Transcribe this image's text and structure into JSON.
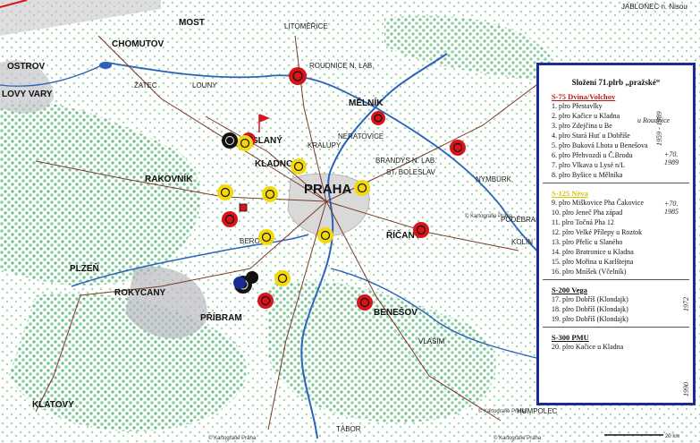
{
  "towns": [
    {
      "name": "MOST",
      "key": "most"
    },
    {
      "name": "LITOMĚŘICE",
      "key": "litomerice"
    },
    {
      "name": "CHOMUTOV",
      "key": "chomutov"
    },
    {
      "name": "OSTROV",
      "key": "ostrov"
    },
    {
      "name": "ŽATEC",
      "key": "zatec"
    },
    {
      "name": "ROUDNICE N. LAB.",
      "key": "roudnice"
    },
    {
      "name": "MĚLNÍK",
      "key": "melnik"
    },
    {
      "name": "SLANÝ",
      "key": "slany"
    },
    {
      "name": "NERATOVICE",
      "key": "neratovice"
    },
    {
      "name": "KRALUPY",
      "key": "kralupy"
    },
    {
      "name": "KLADNO",
      "key": "kladno"
    },
    {
      "name": "BRANDÝS N. LAB.",
      "key": "brandys"
    },
    {
      "name": "ST. BOLESLAV",
      "key": "boleslav"
    },
    {
      "name": "PRAHA",
      "key": "praha"
    },
    {
      "name": "RAKOVNÍK",
      "key": "rakovnik"
    },
    {
      "name": "NYMBURK",
      "key": "nymburk"
    },
    {
      "name": "PODĚBRADY",
      "key": "podebrady"
    },
    {
      "name": "ŘÍČANY",
      "key": "ricany"
    },
    {
      "name": "BEROUN",
      "key": "beroun"
    },
    {
      "name": "PLZEŇ",
      "key": "plzen"
    },
    {
      "name": "ROKYCANY",
      "key": "rokycany"
    },
    {
      "name": "PŘÍBRAM",
      "key": "pribram"
    },
    {
      "name": "BENEŠOV",
      "key": "benesov"
    },
    {
      "name": "VLAŠIM",
      "key": "vlasim"
    },
    {
      "name": "KLATOVY",
      "key": "klatovy"
    },
    {
      "name": "TÁBOR",
      "key": "tabor"
    },
    {
      "name": "HUMPOLEC",
      "key": "humpolec"
    },
    {
      "name": "JABLONEC n. Nisou",
      "key": "jablonec"
    },
    {
      "name": "LOVY VARY",
      "key": "kvary"
    },
    {
      "name": "KOLÍN",
      "key": "kolin"
    },
    {
      "name": "LOUNY",
      "key": "louny"
    }
  ],
  "legend": {
    "title": "Složení 71.plrb „pražské“",
    "sections": [
      {
        "title": "S-75 Dvina/Volchov",
        "color": "red",
        "items": [
          "1.   plro Přestavlky",
          "2.   plro Kačice u Kladna",
          "3.   plro Zdejčina u Be",
          "4.   plro Stará Huť u Dobříše",
          "5.   plro Buková Lhota u Benešova",
          "6.   plro Přehvozdí u Č.Brodu",
          "7.   plro Vlkava u Lysé n/L",
          "8.   plro Byšice u Mělníka"
        ]
      },
      {
        "title": "S-125 Něva",
        "color": "yellow",
        "items": [
          "9.   plro Miškovice Pha Čakovice",
          "10. plro Jeneč Pha západ",
          "11. plro Točná Pha 12",
          "12. plro Velké Přílepy u Roztok",
          "13. plro Přelíc u Slaného",
          "14. plro Bratronice u Kladna",
          "15. plro Mořina u Karlštejna",
          "16. plro Mníšek (Včelník)"
        ]
      },
      {
        "title": "S-200 Vega",
        "color": "black",
        "items": [
          "17. plro Dobříš (Klondajk)",
          "18. plro Dobříš (Klondajk)",
          "19. plro Dobříš (Klondajk)"
        ]
      },
      {
        "title": "S-300 PMU",
        "color": "black",
        "items": [
          "20. plro Kačice u Kladna"
        ]
      }
    ],
    "handwritten": {
      "roudnice": "u Roudnice",
      "years1": "1959 - 1989",
      "years2": "1972 - 1985",
      "years3": "1990",
      "note1": "+70. 1989",
      "note2": "+70. 1985"
    }
  },
  "credits": {
    "c1": "© Kartografie Praha",
    "c2": "© Kartografie Praha",
    "c3": "© Kartografie Praha",
    "c4": "© Kartografie Praha",
    "scale": "20 km"
  },
  "colors": {
    "red": "#d8141a",
    "yellow": "#f4d80a",
    "black": "#111111",
    "river": "#2b63b8",
    "road": "#7a3a2a",
    "forest": "#6ec18a"
  }
}
